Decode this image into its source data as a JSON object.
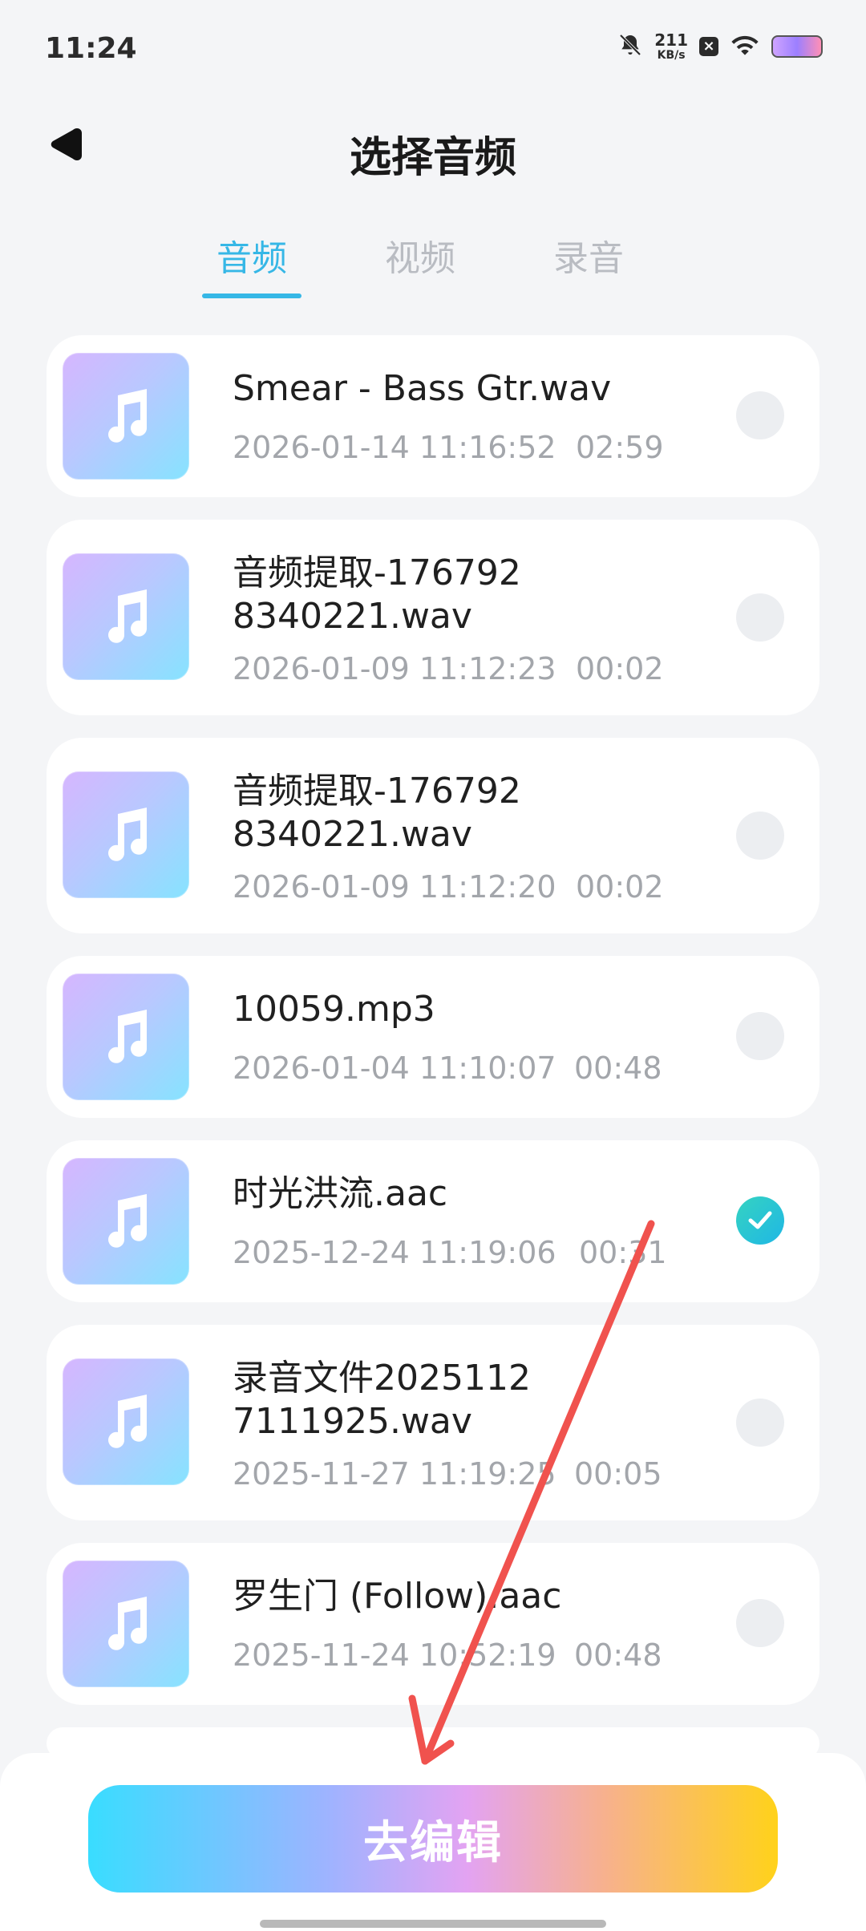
{
  "status_bar": {
    "time": "11:24",
    "net_speed_value": "211",
    "net_speed_unit": "KB/s"
  },
  "header": {
    "title": "选择音频"
  },
  "tabs": [
    {
      "label": "音频",
      "active": true
    },
    {
      "label": "视频",
      "active": false
    },
    {
      "label": "录音",
      "active": false
    }
  ],
  "items": [
    {
      "name": "Smear - Bass Gtr.wav",
      "date": "2026-01-14 11:16:52",
      "duration": "02:59",
      "selected": false
    },
    {
      "name": "音频提取-1767928340221.wav",
      "date": "2026-01-09 11:12:23",
      "duration": "00:02",
      "selected": false
    },
    {
      "name": "音频提取-1767928340221.wav",
      "date": "2026-01-09 11:12:20",
      "duration": "00:02",
      "selected": false
    },
    {
      "name": "10059.mp3",
      "date": "2026-01-04 11:10:07",
      "duration": "00:48",
      "selected": false
    },
    {
      "name": "时光洪流.aac",
      "date": "2025-12-24 11:19:06",
      "duration": "00:31",
      "selected": true
    },
    {
      "name": "录音文件20251127111925.wav",
      "date": "2025-11-27 11:19:25",
      "duration": "00:05",
      "selected": false
    },
    {
      "name": "罗生门 (Follow).aac",
      "date": "2025-11-24 10:52:19",
      "duration": "00:48",
      "selected": false
    }
  ],
  "bottom": {
    "edit_label": "去编辑"
  },
  "colors": {
    "accent": "#36b7e6",
    "arrow": "#f0524e",
    "check": "#2bc4d3"
  },
  "icons": {
    "back": "back-arrow-icon",
    "music": "music-note-icon",
    "check": "check-icon",
    "mute": "bell-off-icon",
    "wifi": "wifi-icon",
    "battery": "battery-icon"
  }
}
